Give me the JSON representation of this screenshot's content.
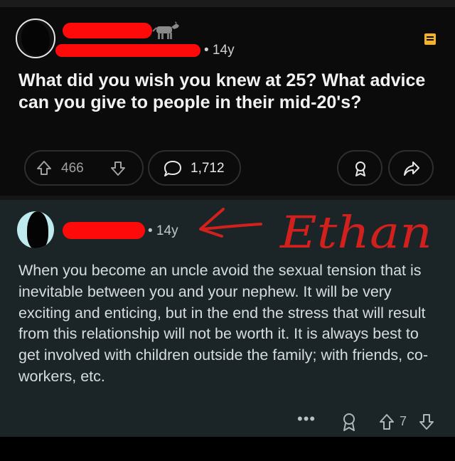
{
  "post": {
    "time": "• 14y",
    "title": "What did you wish you knew at 25? What advice can you give to people in their mid-20's?",
    "votes": "466",
    "comments": "1,712"
  },
  "comment": {
    "time": "• 14y",
    "annotation": "Ethan",
    "body": "When you become an uncle avoid the sexual tension that is inevitable between you and your nephew. It will be very exciting and enticing, but in the end the stress that will result from this relationship will not be worth it. It is always best to get involved with children outside the family; with friends, co-workers, etc.",
    "more": "•••",
    "score": "7"
  },
  "colors": {
    "redaction": "#ff0a0a",
    "annotation_ink": "#d2201c",
    "save_icon": "#f5b324",
    "comment_bg": "#1b2528"
  },
  "icons": [
    "donkey-flair-icon",
    "save-icon",
    "upvote-icon",
    "downvote-icon",
    "comment-bubble-icon",
    "award-icon",
    "share-icon",
    "more-icon"
  ]
}
